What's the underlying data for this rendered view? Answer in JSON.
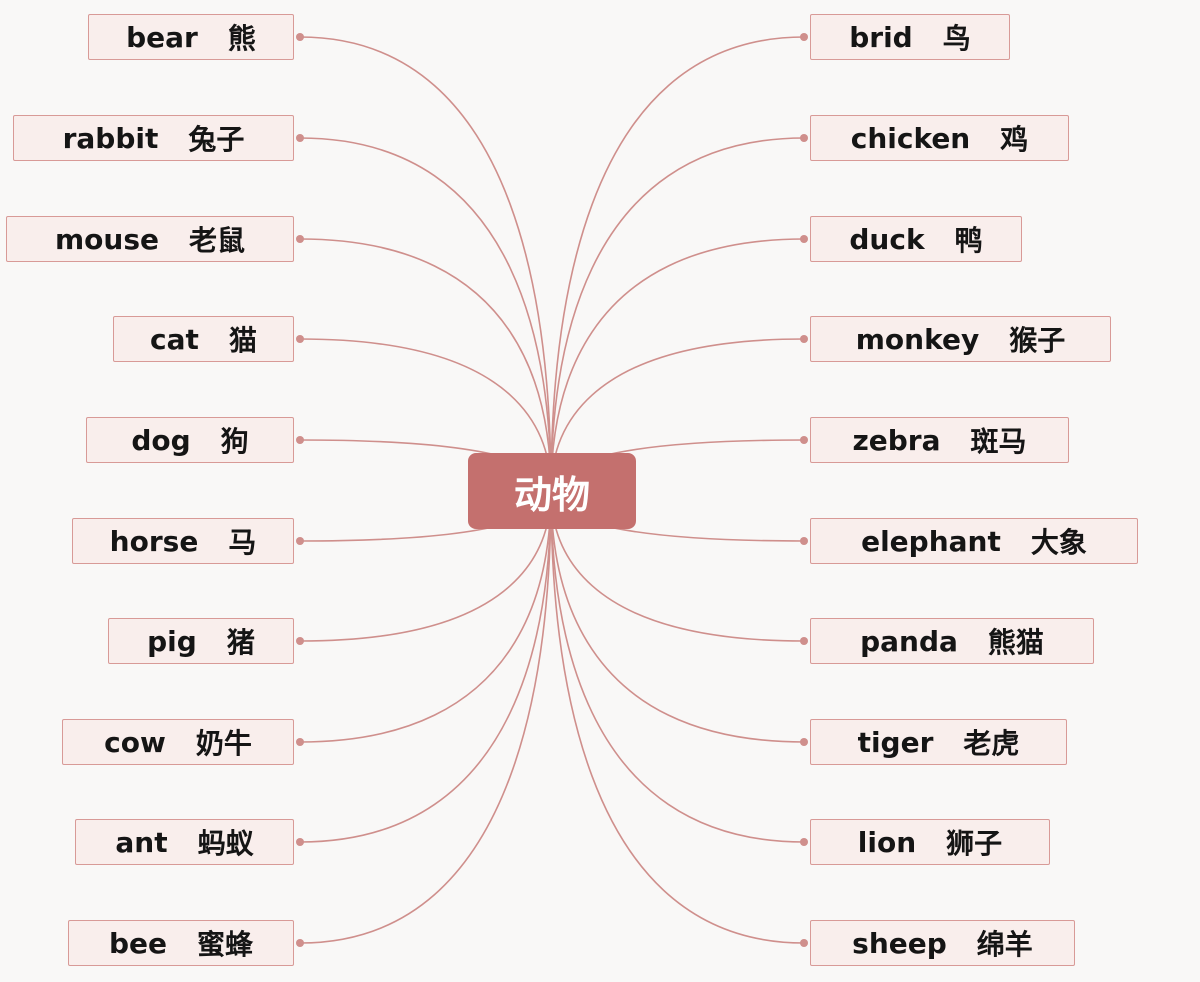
{
  "center": {
    "label": "动物"
  },
  "left": [
    {
      "en": "bear",
      "zh": "熊"
    },
    {
      "en": "rabbit",
      "zh": "兔子"
    },
    {
      "en": "mouse",
      "zh": "老鼠"
    },
    {
      "en": "cat",
      "zh": "猫"
    },
    {
      "en": "dog",
      "zh": "狗"
    },
    {
      "en": "horse",
      "zh": "马"
    },
    {
      "en": "pig",
      "zh": "猪"
    },
    {
      "en": "cow",
      "zh": "奶牛"
    },
    {
      "en": "ant",
      "zh": "蚂蚁"
    },
    {
      "en": "bee",
      "zh": "蜜蜂"
    }
  ],
  "right": [
    {
      "en": "brid",
      "zh": "鸟"
    },
    {
      "en": "chicken",
      "zh": "鸡"
    },
    {
      "en": "duck",
      "zh": "鸭"
    },
    {
      "en": "monkey",
      "zh": "猴子"
    },
    {
      "en": "zebra",
      "zh": "斑马"
    },
    {
      "en": "elephant",
      "zh": "大象"
    },
    {
      "en": "panda",
      "zh": "熊猫"
    },
    {
      "en": "tiger",
      "zh": "老虎"
    },
    {
      "en": "lion",
      "zh": "狮子"
    },
    {
      "en": "sheep",
      "zh": "绵羊"
    }
  ],
  "colors": {
    "line": "#cf8f8c",
    "center_bg": "#c4706e",
    "node_bg": "#f9eeec",
    "node_border": "#d89a97"
  }
}
